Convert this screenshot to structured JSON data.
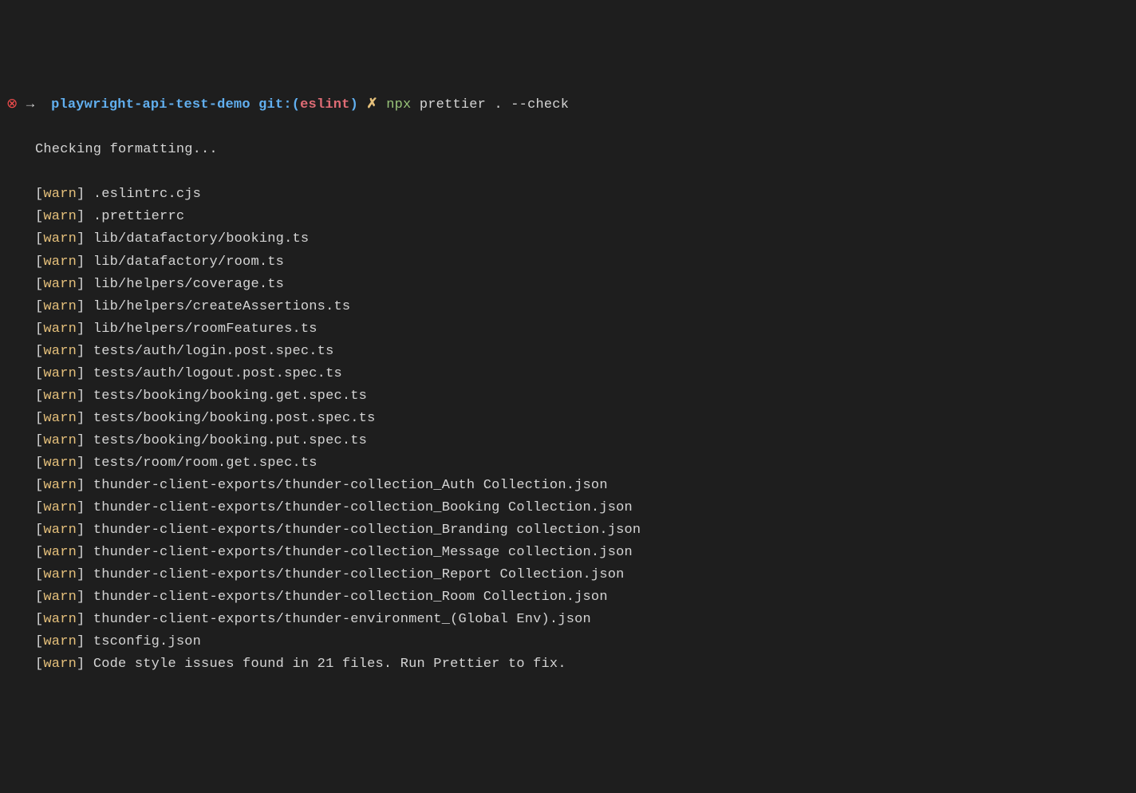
{
  "prompt": {
    "status_icon": "⊗",
    "arrow": "→",
    "repo": "playwright-api-test-demo",
    "git_label": "git:",
    "git_open": "(",
    "branch": "eslint",
    "git_close": ")",
    "symbol": "✗",
    "cmd_npx": "npx",
    "cmd_args": "prettier . --check"
  },
  "checking_line": "Checking formatting...",
  "warn_tag": "warn",
  "warnings": [
    ".eslintrc.cjs",
    ".prettierrc",
    "lib/datafactory/booking.ts",
    "lib/datafactory/room.ts",
    "lib/helpers/coverage.ts",
    "lib/helpers/createAssertions.ts",
    "lib/helpers/roomFeatures.ts",
    "tests/auth/login.post.spec.ts",
    "tests/auth/logout.post.spec.ts",
    "tests/booking/booking.get.spec.ts",
    "tests/booking/booking.post.spec.ts",
    "tests/booking/booking.put.spec.ts",
    "tests/room/room.get.spec.ts",
    "thunder-client-exports/thunder-collection_Auth Collection.json",
    "thunder-client-exports/thunder-collection_Booking Collection.json",
    "thunder-client-exports/thunder-collection_Branding collection.json",
    "thunder-client-exports/thunder-collection_Message collection.json",
    "thunder-client-exports/thunder-collection_Report Collection.json",
    "thunder-client-exports/thunder-collection_Room Collection.json",
    "thunder-client-exports/thunder-environment_(Global Env).json",
    "tsconfig.json",
    "Code style issues found in 21 files. Run Prettier to fix."
  ]
}
